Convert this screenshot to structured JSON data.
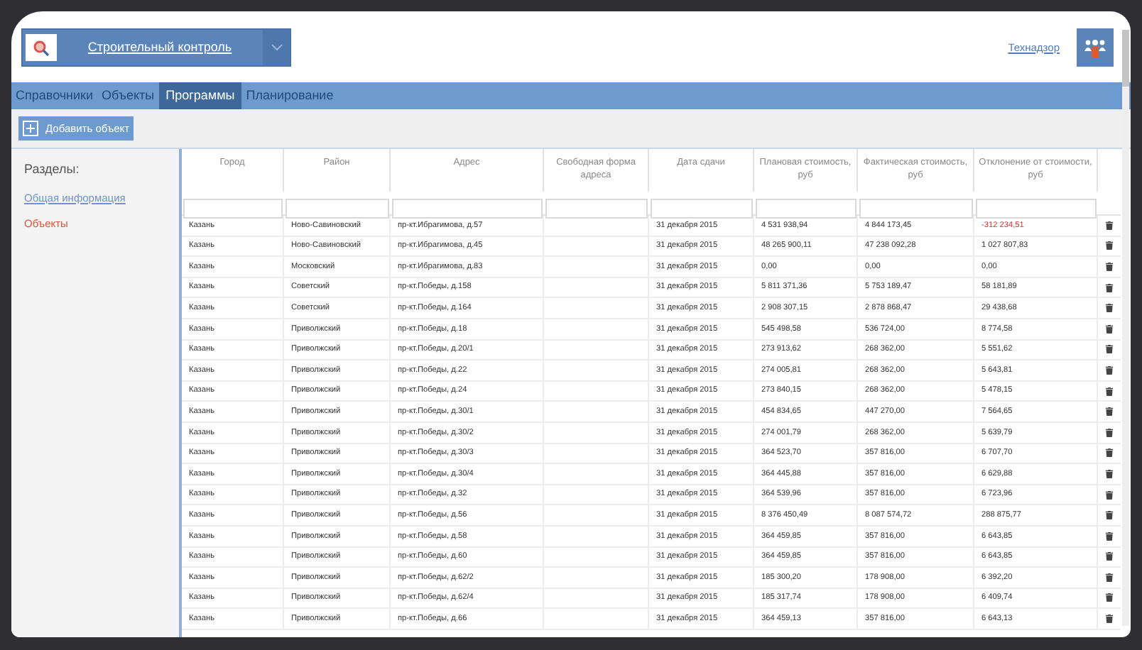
{
  "app_switcher": {
    "title": "Строительный контроль"
  },
  "user": {
    "name": "Технадзор"
  },
  "tabs": [
    {
      "label": "Справочники",
      "selected": false
    },
    {
      "label": "Объекты",
      "selected": false
    },
    {
      "label": "Программы",
      "selected": true
    },
    {
      "label": "Планирование",
      "selected": false
    }
  ],
  "toolbar": {
    "add_button": "Добавить объект"
  },
  "sidebar": {
    "title": "Разделы:",
    "items": [
      {
        "label": "Общая информация",
        "selected": false
      },
      {
        "label": "Объекты",
        "selected": true
      }
    ]
  },
  "table": {
    "columns": [
      "Город",
      "Район",
      "Адрес",
      "Свободная форма адреса",
      "Дата сдачи",
      "Плановая стоимость, руб",
      "Фактическая стоимость, руб",
      "Отклонение от стоимости, руб"
    ],
    "rows": [
      {
        "city": "Казань",
        "district": "Ново-Савиновский",
        "address": "пр-кт.Ибрагимова, д.57",
        "date": "31 декабря 2015",
        "planned": "4 531 938,94",
        "actual": "4 844 173,45",
        "deviation": "-312 234,51",
        "negative": true
      },
      {
        "city": "Казань",
        "district": "Ново-Савиновский",
        "address": "пр-кт.Ибрагимова, д.45",
        "date": "31 декабря 2015",
        "planned": "48 265 900,11",
        "actual": "47 238 092,28",
        "deviation": "1 027 807,83",
        "negative": false
      },
      {
        "city": "Казань",
        "district": "Московский",
        "address": "пр-кт.Ибрагимова, д.83",
        "date": "31 декабря 2015",
        "planned": "0,00",
        "actual": "0,00",
        "deviation": "0,00",
        "negative": false
      },
      {
        "city": "Казань",
        "district": "Советский",
        "address": "пр-кт.Победы, д.158",
        "date": "31 декабря 2015",
        "planned": "5 811 371,36",
        "actual": "5 753 189,47",
        "deviation": "58 181,89",
        "negative": false
      },
      {
        "city": "Казань",
        "district": "Советский",
        "address": "пр-кт.Победы, д.164",
        "date": "31 декабря 2015",
        "planned": "2 908 307,15",
        "actual": "2 878 868,47",
        "deviation": "29 438,68",
        "negative": false
      },
      {
        "city": "Казань",
        "district": "Приволжский",
        "address": "пр-кт.Победы, д.18",
        "date": "31 декабря 2015",
        "planned": "545 498,58",
        "actual": "536 724,00",
        "deviation": "8 774,58",
        "negative": false
      },
      {
        "city": "Казань",
        "district": "Приволжский",
        "address": "пр-кт.Победы, д.20/1",
        "date": "31 декабря 2015",
        "planned": "273 913,62",
        "actual": "268 362,00",
        "deviation": "5 551,62",
        "negative": false
      },
      {
        "city": "Казань",
        "district": "Приволжский",
        "address": "пр-кт.Победы, д.22",
        "date": "31 декабря 2015",
        "planned": "274 005,81",
        "actual": "268 362,00",
        "deviation": "5 643,81",
        "negative": false
      },
      {
        "city": "Казань",
        "district": "Приволжский",
        "address": "пр-кт.Победы, д.24",
        "date": "31 декабря 2015",
        "planned": "273 840,15",
        "actual": "268 362,00",
        "deviation": "5 478,15",
        "negative": false
      },
      {
        "city": "Казань",
        "district": "Приволжский",
        "address": "пр-кт.Победы, д.30/1",
        "date": "31 декабря 2015",
        "planned": "454 834,65",
        "actual": "447 270,00",
        "deviation": "7 564,65",
        "negative": false
      },
      {
        "city": "Казань",
        "district": "Приволжский",
        "address": "пр-кт.Победы, д.30/2",
        "date": "31 декабря 2015",
        "planned": "274 001,79",
        "actual": "268 362,00",
        "deviation": "5 639,79",
        "negative": false
      },
      {
        "city": "Казань",
        "district": "Приволжский",
        "address": "пр-кт.Победы, д.30/3",
        "date": "31 декабря 2015",
        "planned": "364 523,70",
        "actual": "357 816,00",
        "deviation": "6 707,70",
        "negative": false
      },
      {
        "city": "Казань",
        "district": "Приволжский",
        "address": "пр-кт.Победы, д.30/4",
        "date": "31 декабря 2015",
        "planned": "364 445,88",
        "actual": "357 816,00",
        "deviation": "6 629,88",
        "negative": false
      },
      {
        "city": "Казань",
        "district": "Приволжский",
        "address": "пр-кт.Победы, д.32",
        "date": "31 декабря 2015",
        "planned": "364 539,96",
        "actual": "357 816,00",
        "deviation": "6 723,96",
        "negative": false
      },
      {
        "city": "Казань",
        "district": "Приволжский",
        "address": "пр-кт.Победы, д.56",
        "date": "31 декабря 2015",
        "planned": "8 376 450,49",
        "actual": "8 087 574,72",
        "deviation": "288 875,77",
        "negative": false
      },
      {
        "city": "Казань",
        "district": "Приволжский",
        "address": "пр-кт.Победы, д.58",
        "date": "31 декабря 2015",
        "planned": "364 459,85",
        "actual": "357 816,00",
        "deviation": "6 643,85",
        "negative": false
      },
      {
        "city": "Казань",
        "district": "Приволжский",
        "address": "пр-кт.Победы, д.60",
        "date": "31 декабря 2015",
        "planned": "364 459,85",
        "actual": "357 816,00",
        "deviation": "6 643,85",
        "negative": false
      },
      {
        "city": "Казань",
        "district": "Приволжский",
        "address": "пр-кт.Победы, д.62/2",
        "date": "31 декабря 2015",
        "planned": "185 300,20",
        "actual": "178 908,00",
        "deviation": "6 392,20",
        "negative": false
      },
      {
        "city": "Казань",
        "district": "Приволжский",
        "address": "пр-кт.Победы, д.62/4",
        "date": "31 декабря 2015",
        "planned": "185 317,74",
        "actual": "178 908,00",
        "deviation": "6 409,74",
        "negative": false
      },
      {
        "city": "Казань",
        "district": "Приволжский",
        "address": "пр-кт.Победы, д.66",
        "date": "31 декабря 2015",
        "planned": "364 459,13",
        "actual": "357 816,00",
        "deviation": "6 643,13",
        "negative": false
      }
    ]
  }
}
